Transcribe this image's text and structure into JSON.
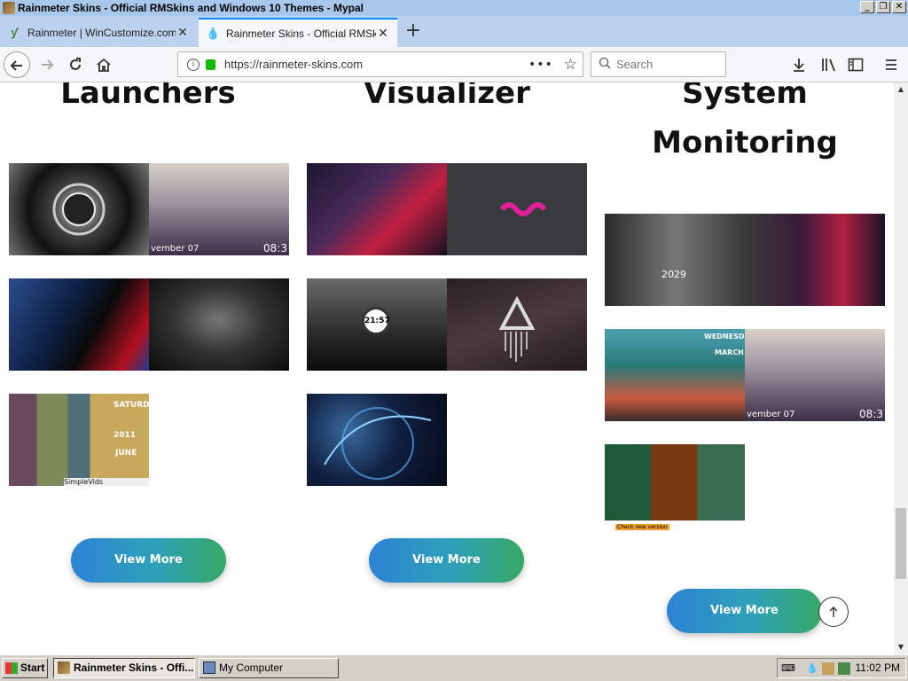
{
  "window": {
    "title": "Rainmeter Skins - Official RMSkins and Windows 10 Themes - Mypal",
    "minimize": "_",
    "restore": "❐",
    "close": "✕"
  },
  "tabs": [
    {
      "label": "Rainmeter | WinCustomize.com",
      "icon": "wincustomize-icon",
      "active": false
    },
    {
      "label": "Rainmeter Skins - Official RMSkins",
      "icon": "rainmeter-drop-icon",
      "active": true
    }
  ],
  "nav": {
    "url": "https://rainmeter-skins.com",
    "search_placeholder": "Search",
    "more_dots": "•••"
  },
  "columns": [
    {
      "title": "Launchers",
      "button": "View More"
    },
    {
      "title": "Visualizer",
      "button": "View More"
    },
    {
      "title_line1": "System",
      "title_line2": "Monitoring",
      "button": "View More"
    }
  ],
  "thumb_labels": {
    "clock1": "21:57",
    "time_08": "08:3",
    "date_07": "vember 07",
    "saturday": "SATURDAY",
    "year2011": "2011",
    "june": "JUNE",
    "simple": "SimpleVids",
    "year2029": "2029",
    "wednesday": "WEDNESDAY",
    "march": "MARCH",
    "check": "Check new version"
  },
  "taskbar": {
    "start": "Start",
    "items": [
      {
        "label": "Rainmeter Skins - Offi...",
        "active": true
      },
      {
        "label": "My Computer",
        "active": false
      }
    ],
    "clock": "11:02 PM"
  }
}
